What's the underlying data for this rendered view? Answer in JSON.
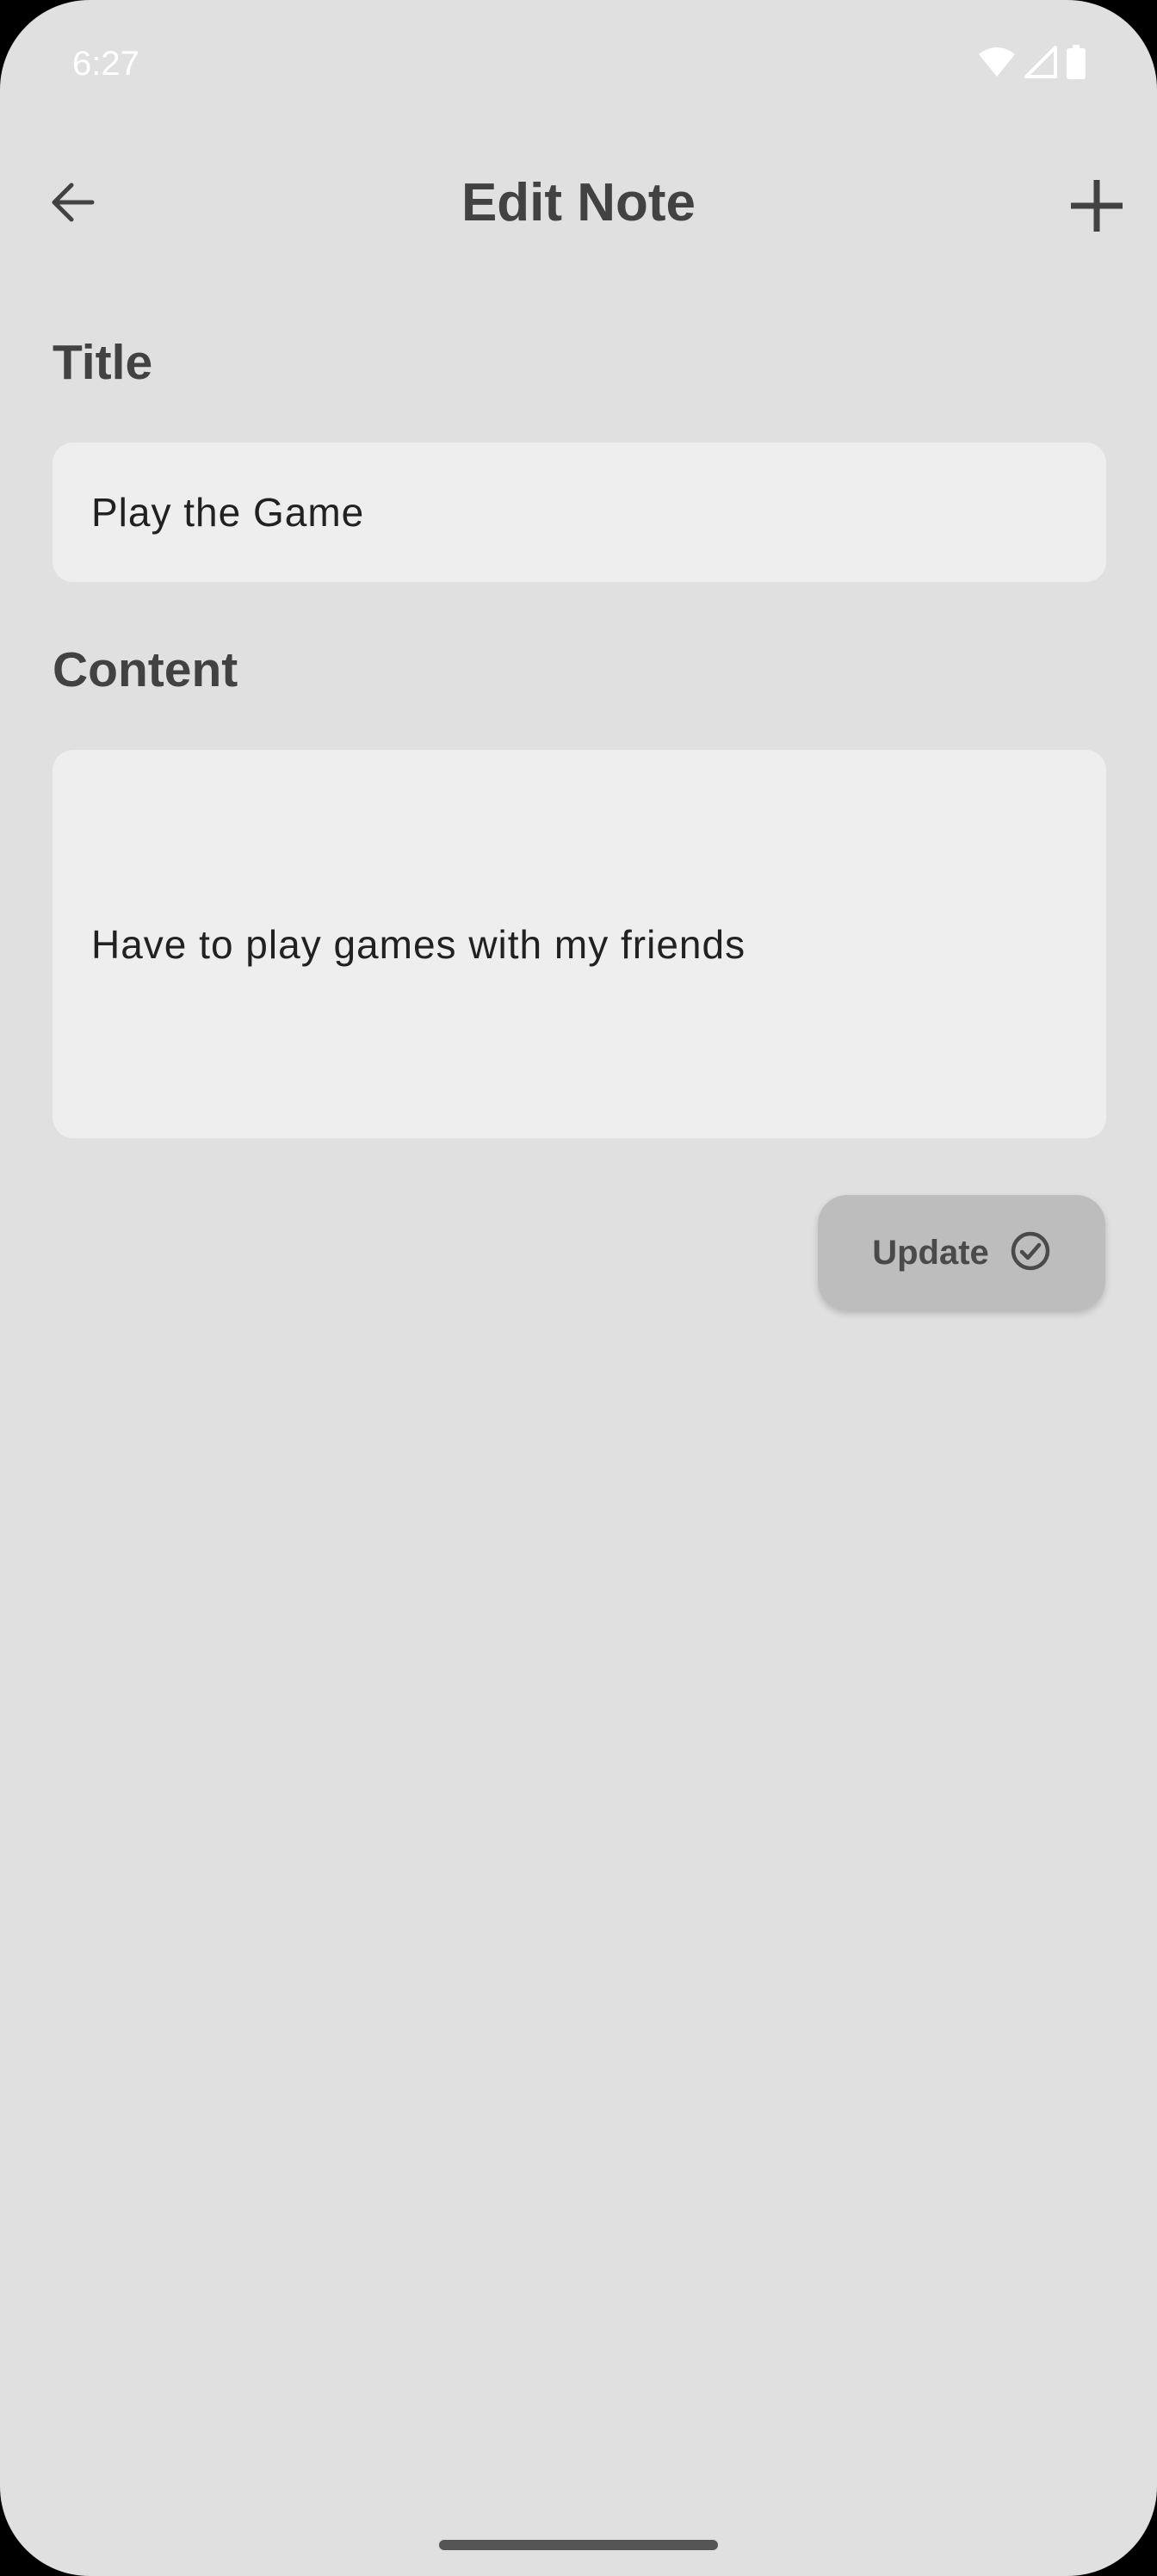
{
  "status_bar": {
    "time": "6:27",
    "icons": [
      "wifi-icon",
      "cell-signal-icon",
      "battery-icon"
    ]
  },
  "app_bar": {
    "title": "Edit Note",
    "back_icon": "arrow-left-icon",
    "add_icon": "plus-icon"
  },
  "form": {
    "title_label": "Title",
    "title_value": "Play the Game",
    "content_label": "Content",
    "content_value": "Have to play games with my friends"
  },
  "update_button": {
    "label": "Update",
    "icon": "check-circle-icon"
  },
  "colors": {
    "background": "#e0e0e0",
    "field_background": "#eeeeee",
    "button_background": "#bdbdbd",
    "text_dark": "#424242"
  }
}
